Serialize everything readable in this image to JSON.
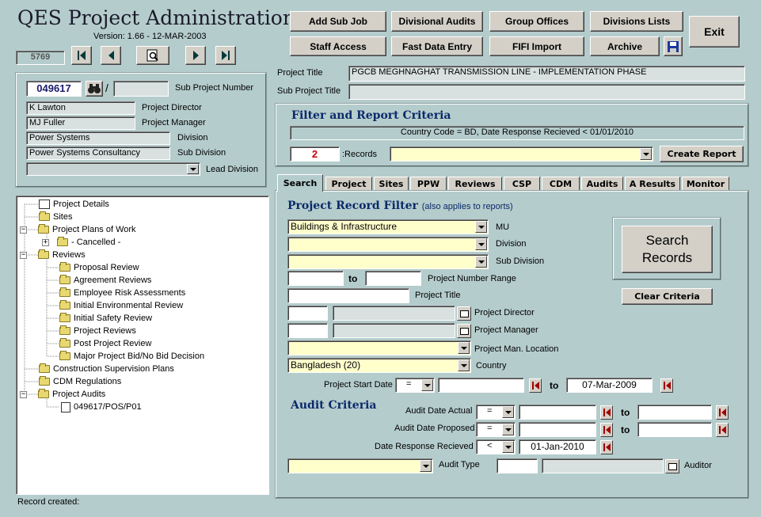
{
  "app": {
    "title": "QES Project Administration",
    "version": "Version: 1.66 - 12-MAR-2003",
    "record_counter": "5769"
  },
  "toolbar": {
    "add_sub_job": "Add Sub Job",
    "divisional_audits": "Divisional Audits",
    "group_offices": "Group Offices",
    "divisions_lists": "Divisions Lists",
    "exit": "Exit",
    "staff_access": "Staff Access",
    "fast_data_entry": "Fast Data Entry",
    "fifi_import": "FIFI Import",
    "archive": "Archive"
  },
  "project": {
    "number": "049617",
    "slash": "/",
    "sub_number": "",
    "sub_number_label": "Sub Project Number",
    "director": "K Lawton",
    "director_label": "Project Director",
    "manager": "MJ Fuller",
    "manager_label": "Project Manager",
    "division": "Power Systems",
    "division_label": "Division",
    "sub_division": "Power Systems Consultancy",
    "sub_division_label": "Sub Division",
    "lead_division": "",
    "lead_division_label": "Lead Division",
    "title_label": "Project Title",
    "title": "PGCB MEGHNAGHAT TRANSMISSION LINE - IMPLEMENTATION PHASE",
    "sub_title_label": "Sub Project Title",
    "sub_title": ""
  },
  "filter": {
    "heading": "Filter and Report Criteria",
    "criteria_text": "Country Code = BD, Date Response Recieved < 01/01/2010",
    "record_count": "2",
    "records_label": ":Records",
    "report_select": "",
    "create_report": "Create Report"
  },
  "tree": {
    "items": [
      {
        "label": "Project Details"
      },
      {
        "label": "Sites"
      },
      {
        "label": "Project Plans of Work"
      },
      {
        "label": "- Cancelled -"
      },
      {
        "label": "Reviews"
      },
      {
        "label": "Proposal Review"
      },
      {
        "label": "Agreement Reviews"
      },
      {
        "label": "Employee Risk Assessments"
      },
      {
        "label": "Initial Environmental Review"
      },
      {
        "label": "Initial Safety Review"
      },
      {
        "label": "Project Reviews"
      },
      {
        "label": "Post Project Review"
      },
      {
        "label": "Major Project Bid/No Bid Decision"
      },
      {
        "label": "Construction Supervision Plans"
      },
      {
        "label": "CDM Regulations"
      },
      {
        "label": "Project Audits"
      },
      {
        "label": "049617/POS/P01"
      }
    ]
  },
  "tabs": [
    {
      "label": "Search"
    },
    {
      "label": "Project"
    },
    {
      "label": "Sites"
    },
    {
      "label": "PPW"
    },
    {
      "label": "Reviews"
    },
    {
      "label": "CSP"
    },
    {
      "label": "CDM"
    },
    {
      "label": "Audits"
    },
    {
      "label": "A Results"
    },
    {
      "label": "Monitor"
    }
  ],
  "search": {
    "heading": "Project Record Filter",
    "heading_note": "(also applies to reports)",
    "mu_value": "Buildings & Infrastructure",
    "mu_label": "MU",
    "division_value": "",
    "division_label": "Division",
    "sub_division_value": "",
    "sub_division_label": "Sub Division",
    "range_from": "",
    "range_to_label": "to",
    "range_to": "",
    "range_label": "Project Number Range",
    "title_value": "",
    "title_label": "Project Title",
    "director_code": "",
    "director_name": "",
    "director_label": "Project Director",
    "manager_code": "",
    "manager_name": "",
    "manager_label": "Project Manager",
    "location_value": "",
    "location_label": "Project Man. Location",
    "country_value": "Bangladesh (20)",
    "country_label": "Country",
    "start_date_label": "Project Start Date",
    "start_op": "=",
    "start_from": "",
    "start_to_label": "to",
    "start_to": "07-Mar-2009",
    "search_records": "Search Records",
    "clear_criteria": "Clear Criteria"
  },
  "audit": {
    "heading": "Audit Criteria",
    "actual_label": "Audit Date Actual",
    "actual_op": "=",
    "actual_from": "",
    "actual_to_label": "to",
    "actual_to": "",
    "proposed_label": "Audit Date Proposed",
    "proposed_op": "=",
    "proposed_from": "",
    "proposed_to_label": "to",
    "proposed_to": "",
    "response_label": "Date Response Recieved",
    "response_op": "<",
    "response_value": "01-Jan-2010",
    "type_value": "",
    "type_label": "Audit Type",
    "auditor_code": "",
    "auditor_name": "",
    "auditor_label": "Auditor"
  },
  "status": {
    "text": "Record created:"
  },
  "colors": {
    "background": "#b5cccc",
    "field_yellow": "#ffffcc",
    "heading_blue": "#0a2a6a",
    "record_red": "#cc0000"
  }
}
